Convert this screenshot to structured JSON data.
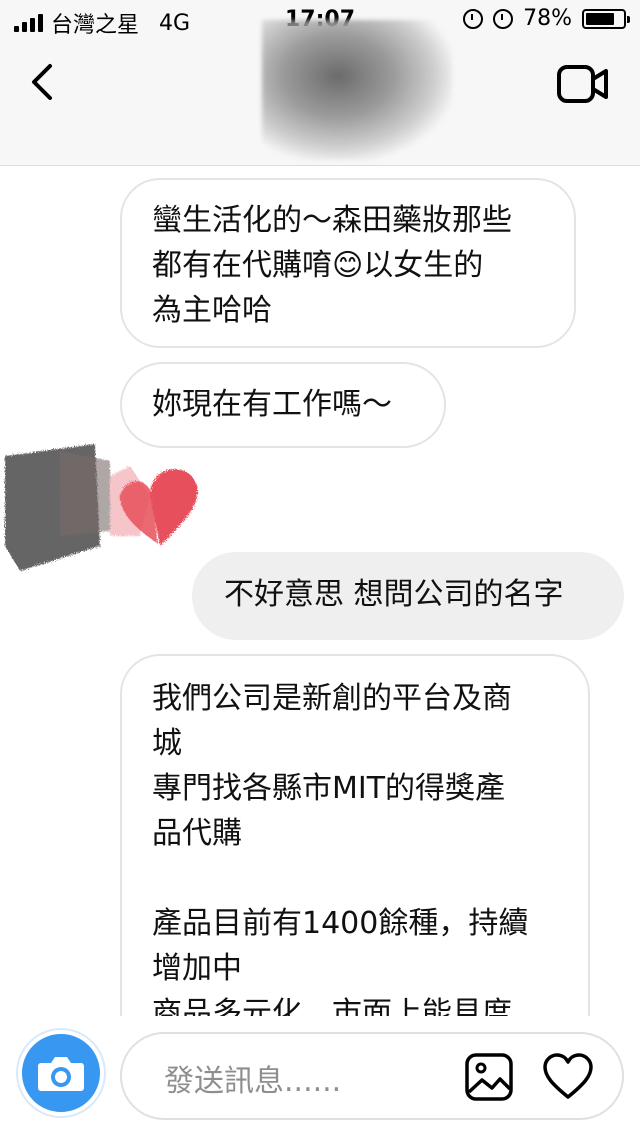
{
  "status_bar": {
    "carrier": "台灣之星",
    "network": "4G",
    "time": "17:07",
    "battery": "78%",
    "battery_level": 0.78
  },
  "header": {
    "back_icon": "chevron-left-icon",
    "video_icon": "video-camera-icon"
  },
  "messages": [
    {
      "side": "incoming",
      "text": "蠻生活化的～森田藥妝那些\n都有在代購唷😊以女生的\n為主哈哈"
    },
    {
      "side": "incoming",
      "text": "妳現在有工作嗎～"
    },
    {
      "side": "outgoing",
      "text": "不好意思 想問公司的名字"
    },
    {
      "side": "incoming",
      "text": "我們公司是新創的平台及商\n城\n專門找各縣市MIT的得獎產\n品代購\n\n產品目前有1400餘種，持續\n增加中\n商品多元化，市面上能見度"
    }
  ],
  "composer": {
    "placeholder": "發送訊息......",
    "camera_icon": "camera-icon",
    "gallery_icon": "gallery-icon",
    "heart_icon": "heart-icon"
  },
  "colors": {
    "accent": "#3897f0",
    "outgoing_bubble": "#efefef",
    "incoming_border": "#e4e4e4"
  }
}
